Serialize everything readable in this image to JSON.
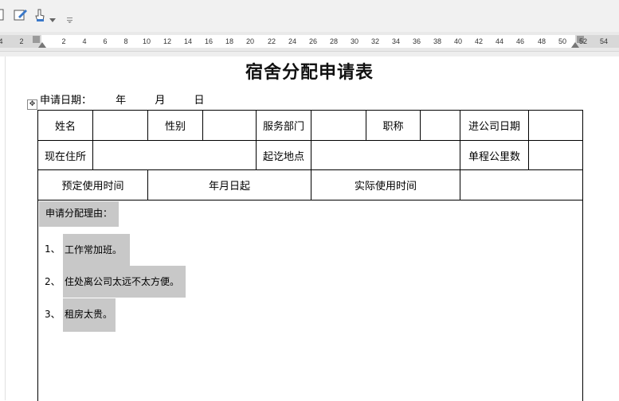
{
  "toolbar": {
    "icons": [
      "page-icon",
      "edit-icon",
      "touch-icon",
      "dropdown-arrow-icon",
      "customize-icon"
    ]
  },
  "ruler": {
    "ticks": [
      "4",
      "2",
      "2",
      "4",
      "6",
      "8",
      "10",
      "12",
      "14",
      "16",
      "18",
      "20",
      "22",
      "24",
      "26",
      "28",
      "30",
      "32",
      "34",
      "36",
      "38",
      "40",
      "42",
      "44",
      "46",
      "48",
      "50",
      "52",
      "54"
    ]
  },
  "document": {
    "title": "宿舍分配申请表",
    "date_label": "申请日期：",
    "year": "年",
    "month": "月",
    "day": "日"
  },
  "table": {
    "row1": [
      "姓名",
      "",
      "性别",
      "",
      "服务部门",
      "",
      "职称",
      "",
      "进公司日期",
      ""
    ],
    "row2": [
      "现在住所",
      "",
      "起讫地点",
      "",
      "单程公里数",
      ""
    ],
    "row3": [
      "预定使用时间",
      "年月日起",
      "实际使用时间",
      ""
    ],
    "reason_title": "申请分配理由：",
    "reasons": [
      {
        "num": "1、",
        "text": "工作常加班。"
      },
      {
        "num": "2、",
        "text": "住处离公司太远不太方便。"
      },
      {
        "num": "3、",
        "text": "租房太贵。"
      }
    ]
  },
  "colors": {
    "highlight": "#c8c8c8",
    "toolbar_bg": "#f1f1f1",
    "ruler_bg": "#e9e9e9"
  }
}
